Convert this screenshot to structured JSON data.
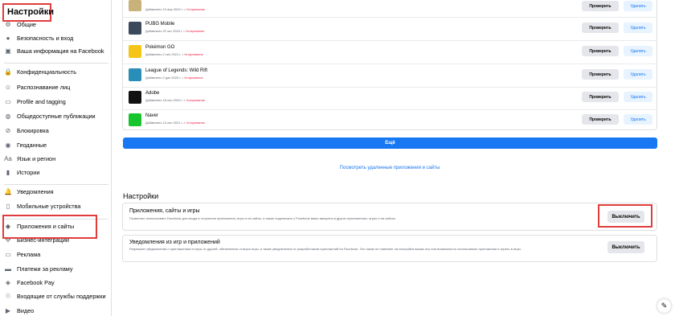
{
  "sidebar": {
    "title": "Настройки",
    "items": [
      {
        "label": "Общие",
        "icon": "gear-icon",
        "glyph": "⚙"
      },
      {
        "label": "Безопасность и вход",
        "icon": "shield-icon",
        "glyph": "●"
      },
      {
        "label": "Ваша информация на Facebook",
        "icon": "facebook-icon",
        "glyph": "▣"
      },
      {
        "label": "Конфиденциальность",
        "icon": "lock-icon",
        "glyph": "🔒"
      },
      {
        "label": "Распознавание лиц",
        "icon": "face-icon",
        "glyph": "☺"
      },
      {
        "label": "Profile and tagging",
        "icon": "tag-icon",
        "glyph": "▭"
      },
      {
        "label": "Общедоступные публикации",
        "icon": "globe-icon",
        "glyph": "◍"
      },
      {
        "label": "Блокировка",
        "icon": "block-icon",
        "glyph": "⊘"
      },
      {
        "label": "Геоданные",
        "icon": "location-icon",
        "glyph": "◉"
      },
      {
        "label": "Язык и регион",
        "icon": "language-icon",
        "glyph": "Aa"
      },
      {
        "label": "Истории",
        "icon": "stories-icon",
        "glyph": "▮"
      },
      {
        "label": "Уведомления",
        "icon": "bell-icon",
        "glyph": "🔔"
      },
      {
        "label": "Мобильные устройства",
        "icon": "mobile-icon",
        "glyph": "▯"
      },
      {
        "label": "Приложения и сайты",
        "icon": "apps-icon",
        "glyph": "◆"
      },
      {
        "label": "Бизнес-интеграции",
        "icon": "integrations-icon",
        "glyph": "✣"
      },
      {
        "label": "Реклама",
        "icon": "ads-icon",
        "glyph": "▭"
      },
      {
        "label": "Платежи за рекламу",
        "icon": "payment-icon",
        "glyph": "▬"
      },
      {
        "label": "Facebook Pay",
        "icon": "pay-icon",
        "glyph": "◈"
      },
      {
        "label": "Входящие от службы поддержки",
        "icon": "support-icon",
        "glyph": "☉"
      },
      {
        "label": "Видео",
        "icon": "video-icon",
        "glyph": "▶"
      }
    ]
  },
  "apps": {
    "check_label": "Проверить",
    "remove_label": "Удалить",
    "status_label": "Устаревание",
    "rows": [
      {
        "name": "PUBG Mobile",
        "date": "Добавлено 22 окт 2020 г.",
        "logo_color": "#3a4a5c"
      },
      {
        "name": "Pokémon GO",
        "date": "Добавлено 2 сен 2021 г.",
        "logo_color": "#f5c518"
      },
      {
        "name": "League of Legends: Wild Rift",
        "date": "Добавлено 2 дек 2020 г.",
        "logo_color": "#2a8fb8"
      },
      {
        "name": "Adobe",
        "date": "Добавлено 18 сен 2020 г.",
        "logo_color": "#111111"
      },
      {
        "name": "Naver",
        "date": "Добавлено 13 сен 2021 г.",
        "logo_color": "#19c52d"
      }
    ],
    "top_partial_date": "Добавлено 10 апр 2020 г."
  },
  "more_button": "Ещё",
  "deleted_link": "Посмотреть удаленные приложения и сайты",
  "settings_section": {
    "title": "Настройки",
    "cards": [
      {
        "title": "Приложения, сайты и игры",
        "desc": "Позволяет использовать Facebook для входа в сторонние приложения, игры и на сайты, а также подключать к Facebook ваши аккаунты в других приложениях, играх и на сайтах.",
        "button": "Выключить"
      },
      {
        "title": "Уведомления из игр и приложений",
        "desc": "Разрешает уведомления о приглашениях в игры от друзей, обновлениях статуса игры, а также уведомления от разработчиков приложений на Facebook. Это никак не повлияет на настройки ваших игр или возможность использовать приложения и играть в игры.",
        "button": "Выключить"
      }
    ]
  },
  "colors": {
    "accent": "#1877f2",
    "highlight": "#e03c3c"
  }
}
